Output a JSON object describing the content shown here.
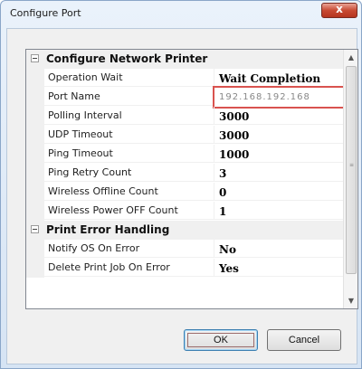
{
  "window": {
    "title": "Configure Port",
    "close_glyph": "x"
  },
  "grid": {
    "categories": [
      {
        "label": "Configure Network Printer",
        "expander": "-",
        "properties": [
          {
            "name": "Operation Wait",
            "value": "Wait Completion"
          },
          {
            "name": "Port Name",
            "value": "192.168.192.168",
            "editing": true
          },
          {
            "name": "Polling Interval",
            "value": "3000"
          },
          {
            "name": "UDP Timeout",
            "value": "3000"
          },
          {
            "name": "Ping Timeout",
            "value": "1000"
          },
          {
            "name": "Ping Retry Count",
            "value": "3"
          },
          {
            "name": "Wireless Offline Count",
            "value": "0"
          },
          {
            "name": "Wireless Power OFF Count",
            "value": "1"
          }
        ]
      },
      {
        "label": "Print Error Handling",
        "expander": "-",
        "properties": [
          {
            "name": "Notify OS On Error",
            "value": "No"
          },
          {
            "name": "Delete Print Job On Error",
            "value": "Yes"
          }
        ]
      }
    ]
  },
  "scrollbar": {
    "up_glyph": "▲",
    "down_glyph": "▼",
    "grip_glyph": "≡"
  },
  "buttons": {
    "ok_label": "OK",
    "cancel_label": "Cancel"
  }
}
